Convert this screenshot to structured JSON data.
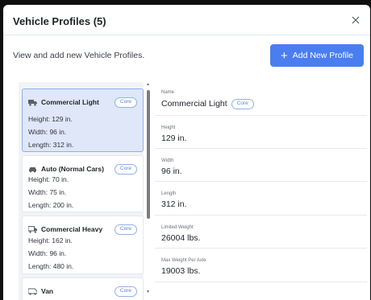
{
  "modal": {
    "title": "Vehicle Profiles (5)",
    "close_icon": "close-icon"
  },
  "description": "View and add new Vehicle Profiles.",
  "add_button": {
    "label": "Add New Profile",
    "icon": "plus-icon",
    "color": "#4a7ef0"
  },
  "profiles": [
    {
      "name": "Commercial Light",
      "badge": "Core",
      "icon": "truck-icon",
      "selected": true,
      "height": "Height: 129 in.",
      "width": "Width: 96 in.",
      "length": "Length: 312 in."
    },
    {
      "name": "Auto (Normal Cars)",
      "badge": "Core",
      "icon": "car-icon",
      "selected": false,
      "height": "Height: 70 in.",
      "width": "Width: 75 in.",
      "length": "Length: 200 in."
    },
    {
      "name": "Commercial Heavy",
      "badge": "Core",
      "icon": "heavy-truck-icon",
      "selected": false,
      "height": "Height: 162 in.",
      "width": "Width: 96 in.",
      "length": "Length: 480 in."
    },
    {
      "name": "Van",
      "badge": "Core",
      "icon": "van-icon",
      "selected": false
    }
  ],
  "detail": {
    "name_label": "Name",
    "name_value": "Commercial Light",
    "name_badge": "Core",
    "height_label": "Height",
    "height_value": "129 in.",
    "width_label": "Width",
    "width_value": "96 in.",
    "length_label": "Length",
    "length_value": "312 in.",
    "limited_weight_label": "Limited Weight",
    "limited_weight_value": "26004 lbs.",
    "max_weight_label": "Max Weight Per Axle",
    "max_weight_value": "19003 lbs."
  },
  "colors": {
    "accent": "#4a7ef0",
    "selected_bg": "#dfe7f8",
    "badge_border": "#8fb0ea"
  }
}
